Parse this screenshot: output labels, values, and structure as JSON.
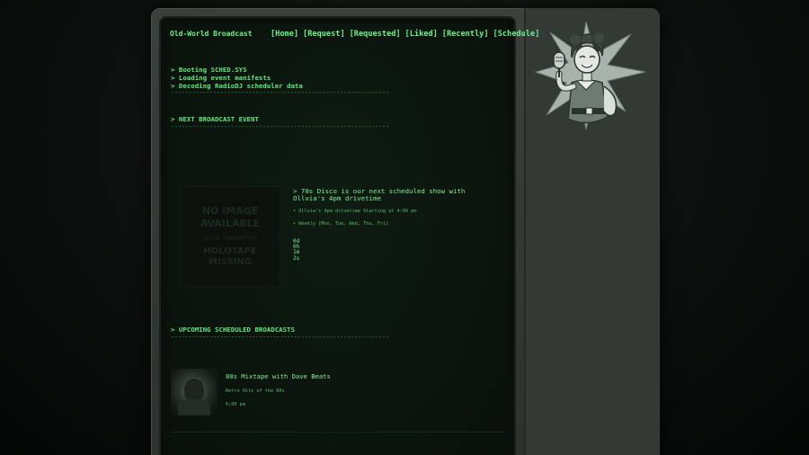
{
  "header": {
    "site_title": "Old-World Broadcast",
    "nav": [
      "[Home]",
      "[Request]",
      "[Requested]",
      "[Liked]",
      "[Recently]",
      "[Schedule]"
    ]
  },
  "boot": {
    "lines": [
      "> Booting SCHED.SYS",
      "> Loading event manifests",
      "> Decoding RadioDJ scheduler data"
    ],
    "rule": "--------------------------------------------------------------"
  },
  "next_event": {
    "heading": "> NEXT BROADCAST EVENT",
    "rule": "--------------------------------------------------------------",
    "placeholder": {
      "line1": "NO IMAGE",
      "line2": "AVAILABLE",
      "line3": "[DATA CORRUPTED]",
      "line4": "HOLOTAPE",
      "line5": "MISSING"
    },
    "title": "> 70s Disco is our next scheduled show with Ollvia's 4pm drivetime",
    "detail": "• Ollvia's 4pm drivetime Starting at 4:00 pm",
    "recurrence": "• Weekly [Mon, Tue, Wed, Thu, Fri]",
    "countdown": [
      "0d",
      "0h",
      "1m",
      "2s"
    ]
  },
  "upcoming": {
    "heading": "> UPCOMING SCHEDULED BROADCASTS",
    "rule": "--------------------------------------------------------------",
    "items": [
      {
        "title": "80s Mixtape with Dave Beats",
        "description": "Retro Hits of the 80s",
        "time": "6:00 pm"
      }
    ]
  },
  "colors": {
    "terminal_green": "#6ff08a",
    "dim_green": "#58b56c",
    "screen_bg": "#0b140d",
    "bezel": "#333a36"
  },
  "icons": {
    "mascot": "pinup-radio-host-with-microphone-illustration"
  }
}
